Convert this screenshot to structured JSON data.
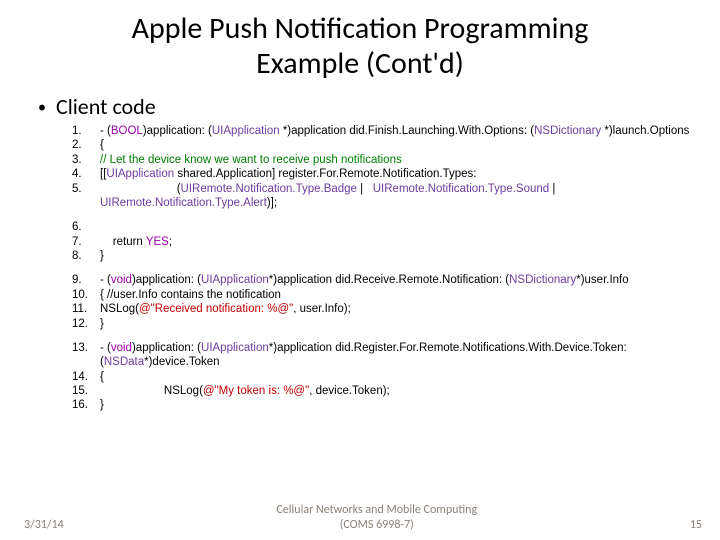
{
  "title_line1": "Apple Push Notification Programming",
  "title_line2": "Example (Cont'd)",
  "bullet": "Client code",
  "lines": {
    "l1n": "1.",
    "l2n": "2.",
    "l3n": "3.",
    "l4n": "4.",
    "l5n": "5.",
    "l6n": "6.",
    "l7n": "7.",
    "l8n": "8.",
    "l9n": "9.",
    "l10n": "10.",
    "l11n": "11.",
    "l12n": "12.",
    "l13n": "13.",
    "l14n": "14.",
    "l15n": "15.",
    "l16n": "16."
  },
  "code": {
    "c1a": "- (",
    "c1b": "BOOL",
    "c1c": ")application: (",
    "c1d": "UIApplication",
    "c1e": " *)application did.Finish.Launching.With.Options: (",
    "c1f": "NSDictionary",
    "c1g": " *)launch.Options",
    "c2": "{",
    "c3": "// Let the device know we want to receive push notifications",
    "c4a": "[[",
    "c4b": "UIApplication",
    "c4c": " shared.Application] register.For.Remote.Notification.Types:",
    "c5a": "                        (",
    "c5b": "UIRemote.Notification.Type.Badge",
    "c5c": " |   ",
    "c5d": "UIRemote.Notification.Type.Sound",
    "c5e": " | ",
    "c5f": "UIRemote.Notification.Type.Alert",
    "c5g": ")];",
    "c7a": "    return ",
    "c7b": "YES",
    "c7c": ";",
    "c8": "}",
    "c9a": "- (",
    "c9b": "void",
    "c9c": ")application: (",
    "c9d": "UIApplication",
    "c9e": "*)application did.Receive.Remote.Notification: (",
    "c9f": "NSDictionary",
    "c9g": "*)user.Info",
    "c10": "{ //user.Info contains the notification",
    "c11a": "NSLog(",
    "c11b": "@\"Received notification: %@\"",
    "c11c": ", user.Info);",
    "c12": "}",
    "c13a": "- (",
    "c13b": "void",
    "c13c": ")application: (",
    "c13d": "UIApplication",
    "c13e": "*)application did.Register.For.Remote.Notifications.With.Device.Token: (",
    "c13f": "NSData",
    "c13g": "*)device.Token",
    "c14": "{",
    "c15a": "                    NSLog(",
    "c15b": "@\"My token is: %@\"",
    "c15c": ", device.Token);",
    "c16": "}"
  },
  "footer": {
    "date": "3/31/14",
    "center1": "Cellular Networks and Mobile Computing",
    "center2": "(COMS 6998-7)",
    "page": "15"
  }
}
